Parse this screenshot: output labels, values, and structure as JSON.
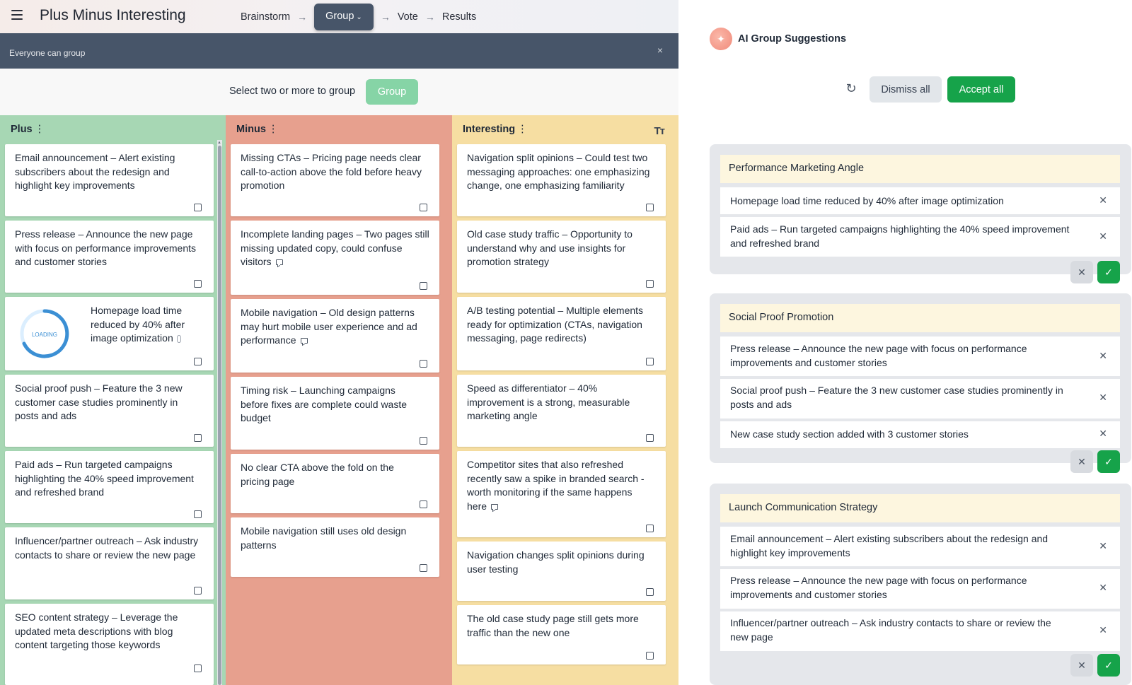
{
  "app": {
    "title": "Plus Minus Interesting"
  },
  "steps": {
    "brainstorm": "Brainstorm",
    "group": "Group",
    "vote": "Vote",
    "results": "Results",
    "arrow": "→"
  },
  "banner": {
    "text": "Everyone can group",
    "close": "×"
  },
  "select": {
    "text": "Select two or more to group",
    "group_button": "Group"
  },
  "columns": {
    "plus": {
      "title": "Plus",
      "cards": [
        "Email announcement – Alert existing subscribers about the redesign and highlight key improvements",
        "Press release – Announce the new page with focus on performance improvements and customer stories",
        "Homepage load time reduced by 40% after image optimization",
        "Social proof push – Feature the 3 new customer case studies prominently in posts and ads",
        "Paid ads – Run targeted campaigns highlighting the 40% speed improvement and refreshed brand",
        "Influencer/partner outreach – Ask industry contacts to share or review the new page",
        "SEO content strategy – Leverage the updated meta descriptions with blog content targeting those keywords"
      ],
      "loading_label": "LOADING"
    },
    "minus": {
      "title": "Minus",
      "cards": [
        "Missing CTAs – Pricing page needs clear call-to-action above the fold before heavy promotion",
        "Incomplete landing pages – Two pages still missing updated copy, could confuse visitors",
        "Mobile navigation – Old design patterns may hurt mobile user experience and ad performance",
        "Timing risk – Launching campaigns before fixes are complete could waste budget",
        "No clear CTA above the fold on the pricing page",
        "Mobile navigation still uses old design patterns"
      ]
    },
    "interesting": {
      "title": "Interesting",
      "text_size_icon": "Tт",
      "cards": [
        "Navigation split opinions – Could test two messaging approaches: one emphasizing change, one emphasizing familiarity",
        "Old case study traffic – Opportunity to understand why and use insights for promotion strategy",
        "A/B testing potential – Multiple elements ready for optimization (CTAs, navigation messaging, page redirects)",
        "Speed as differentiator – 40% improvement is a strong, measurable marketing angle",
        "Competitor sites that also refreshed recently saw a spike in branded search - worth monitoring if the same happens here",
        "Navigation changes split opinions during user testing",
        "The old case study page still gets more traffic than the new one"
      ]
    }
  },
  "panel": {
    "title": "AI Group Suggestions",
    "dismiss_all": "Dismiss all",
    "accept_all": "Accept all",
    "groups": [
      {
        "title": "Performance Marketing Angle",
        "items": [
          "Homepage load time reduced by 40% after image optimization",
          "Paid ads – Run targeted campaigns highlighting the 40% speed improvement and refreshed brand"
        ]
      },
      {
        "title": "Social Proof Promotion",
        "items": [
          "Press release – Announce the new page with focus on performance improvements and customer stories",
          "Social proof push – Feature the 3 new customer case studies prominently in posts and ads",
          "New case study section added with 3 customer stories"
        ]
      },
      {
        "title": "Launch Communication Strategy",
        "items": [
          "Email announcement – Alert existing subscribers about the redesign and highlight key improvements",
          "Press release – Announce the new page with focus on performance improvements and customer stories",
          "Influencer/partner outreach – Ask industry contacts to share or review the new page"
        ]
      }
    ]
  },
  "colors": {
    "plus": "#a7d7b4",
    "minus": "#e7a08e",
    "interesting": "#f6dea2",
    "banner": "#475569",
    "accent_green": "#16a34a"
  },
  "icons": {
    "menu": "hamburger-icon",
    "close": "close-icon",
    "refresh": "refresh-icon",
    "ai": "sparkle-icon",
    "check": "check-icon",
    "comment": "comment-icon",
    "attachment": "paperclip-icon",
    "checkbox": "checkbox-icon"
  }
}
